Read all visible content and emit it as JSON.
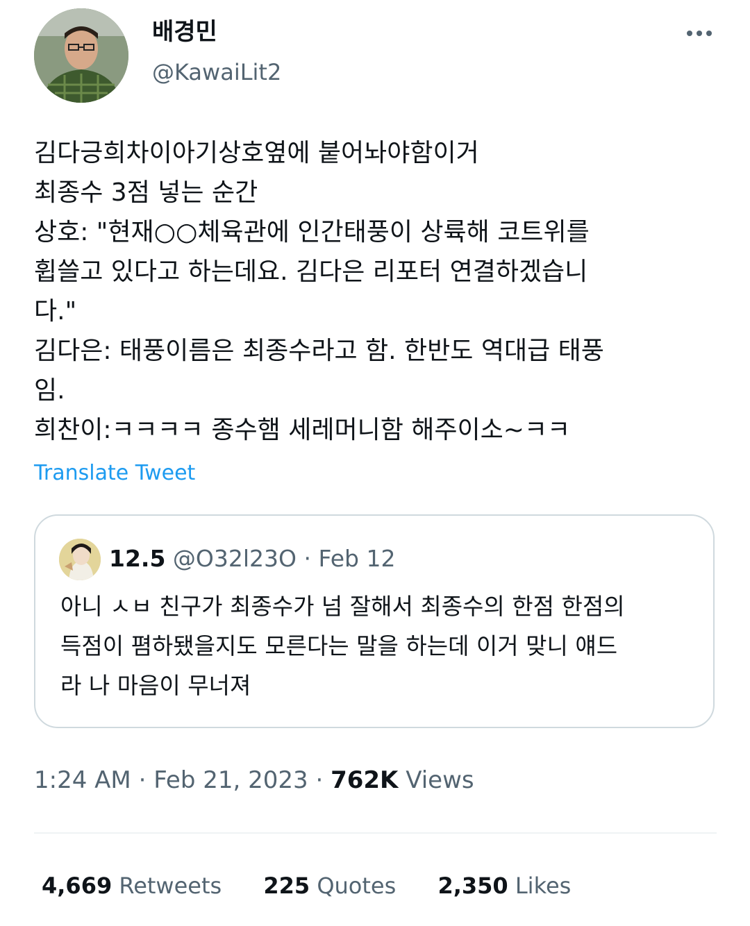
{
  "author": {
    "display_name": "배경민",
    "handle": "@KawaiLit2"
  },
  "tweet": {
    "lines": [
      "김다긍희차이아기상호옆에 붙어놔야함이거",
      "최종수 3점 넣는 순간",
      "상호: \"현재○○체육관에 인간태풍이 상륙해 코트위를",
      "휩쓸고 있다고 하는데요. 김다은 리포터 연결하겠습니",
      "다.\"",
      "김다은: 태풍이름은 최종수라고 함. 한반도 역대급 태풍",
      "임.",
      "희찬이:ㅋㅋㅋㅋ 종수햄 세레머니함 해주이소~ㅋㅋ"
    ],
    "translate_label": "Translate Tweet"
  },
  "quote": {
    "name": "12.5",
    "handle": "@O32l23O",
    "separator": "·",
    "date": "Feb 12",
    "lines": [
      "아니 ㅅㅂ 친구가 최종수가 넘 잘해서 최종수의 한점 한점의",
      "득점이 폄하됐을지도 모른다는 말을 하는데 이거 맞니 얘드",
      "라 나 마음이 무너져"
    ]
  },
  "meta": {
    "time": "1:24 AM",
    "sep1": "·",
    "date": "Feb 21, 2023",
    "sep2": "·",
    "views_count": "762K",
    "views_label": "Views"
  },
  "stats": {
    "retweets_count": "4,669",
    "retweets_label": "Retweets",
    "quotes_count": "225",
    "quotes_label": "Quotes",
    "likes_count": "2,350",
    "likes_label": "Likes"
  },
  "colors": {
    "link": "#1d9bf0",
    "secondary_text": "#536471",
    "border": "#cfd9de"
  },
  "icons": {
    "more": "more-options-icon"
  }
}
